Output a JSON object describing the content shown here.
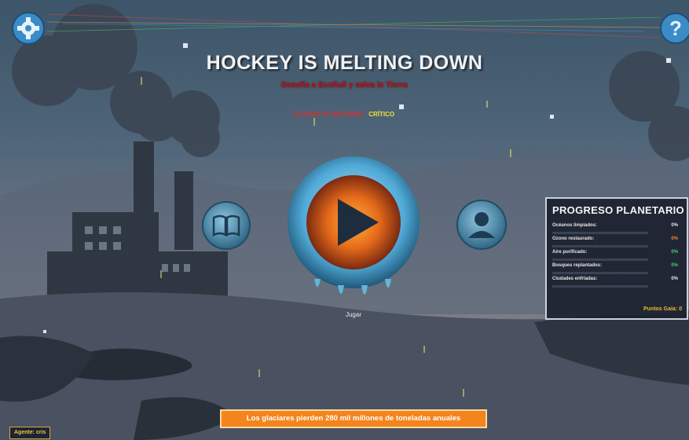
{
  "header": {
    "title": "HOCKEY IS MELTING DOWN",
    "subtitle": "Desafía a Ecofiull y salva la Tierra",
    "status_label": "ESTADO PLANETARIO:",
    "status_value": "CRÍTICO"
  },
  "buttons": {
    "settings_icon": "gear-icon",
    "help_icon": "question-mark-icon",
    "play_icon": "play-icon",
    "book_icon": "book-icon",
    "profile_icon": "user-icon",
    "play_label": "Jugar"
  },
  "progress_panel": {
    "title": "PROGRESO PLANETARIO",
    "rows": [
      {
        "label": "Océanos limpiados:",
        "value": "0%",
        "value_color": "#e6e6e6",
        "fill": 0
      },
      {
        "label": "Ozono restaurado:",
        "value": "0%",
        "value_color": "#f08a24",
        "fill": 0
      },
      {
        "label": "Aire purificado:",
        "value": "0%",
        "value_color": "#3fd07a",
        "fill": 0
      },
      {
        "label": "Bosques replantados:",
        "value": "0%",
        "value_color": "#3fd07a",
        "fill": 0
      },
      {
        "label": "Ciudades enfriadas:",
        "value": "0%",
        "value_color": "#e6e6e6",
        "fill": 0
      }
    ],
    "points": "Puntos Gaia: 0"
  },
  "fact_banner": "Los glaciares pierden 280 mil millones de toneladas anuales",
  "agent_badge": "Agente: cris",
  "colors": {
    "accent_orange": "#f4841d",
    "danger_red": "#c1121b",
    "status_yellow": "#f2e13a",
    "points_gold": "#e9b92f",
    "ice_blue": "#7ec6e8"
  }
}
